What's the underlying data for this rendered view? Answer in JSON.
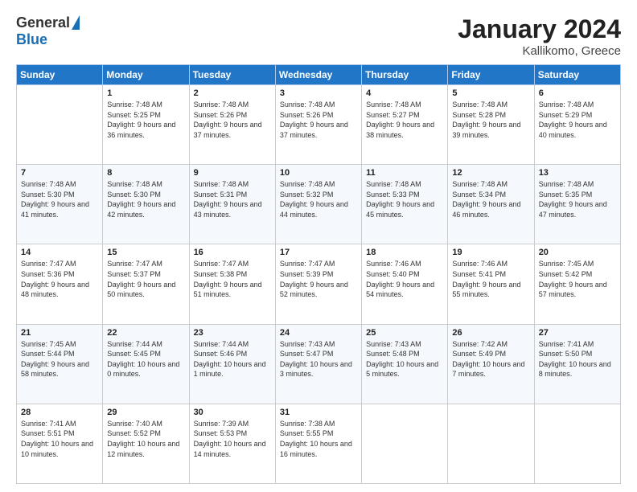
{
  "logo": {
    "general": "General",
    "blue": "Blue"
  },
  "header": {
    "title": "January 2024",
    "subtitle": "Kallikomo, Greece"
  },
  "days_of_week": [
    "Sunday",
    "Monday",
    "Tuesday",
    "Wednesday",
    "Thursday",
    "Friday",
    "Saturday"
  ],
  "weeks": [
    [
      {
        "day": "",
        "sunrise": "",
        "sunset": "",
        "daylight": ""
      },
      {
        "day": "1",
        "sunrise": "Sunrise: 7:48 AM",
        "sunset": "Sunset: 5:25 PM",
        "daylight": "Daylight: 9 hours and 36 minutes."
      },
      {
        "day": "2",
        "sunrise": "Sunrise: 7:48 AM",
        "sunset": "Sunset: 5:26 PM",
        "daylight": "Daylight: 9 hours and 37 minutes."
      },
      {
        "day": "3",
        "sunrise": "Sunrise: 7:48 AM",
        "sunset": "Sunset: 5:26 PM",
        "daylight": "Daylight: 9 hours and 37 minutes."
      },
      {
        "day": "4",
        "sunrise": "Sunrise: 7:48 AM",
        "sunset": "Sunset: 5:27 PM",
        "daylight": "Daylight: 9 hours and 38 minutes."
      },
      {
        "day": "5",
        "sunrise": "Sunrise: 7:48 AM",
        "sunset": "Sunset: 5:28 PM",
        "daylight": "Daylight: 9 hours and 39 minutes."
      },
      {
        "day": "6",
        "sunrise": "Sunrise: 7:48 AM",
        "sunset": "Sunset: 5:29 PM",
        "daylight": "Daylight: 9 hours and 40 minutes."
      }
    ],
    [
      {
        "day": "7",
        "sunrise": "Sunrise: 7:48 AM",
        "sunset": "Sunset: 5:30 PM",
        "daylight": "Daylight: 9 hours and 41 minutes."
      },
      {
        "day": "8",
        "sunrise": "Sunrise: 7:48 AM",
        "sunset": "Sunset: 5:30 PM",
        "daylight": "Daylight: 9 hours and 42 minutes."
      },
      {
        "day": "9",
        "sunrise": "Sunrise: 7:48 AM",
        "sunset": "Sunset: 5:31 PM",
        "daylight": "Daylight: 9 hours and 43 minutes."
      },
      {
        "day": "10",
        "sunrise": "Sunrise: 7:48 AM",
        "sunset": "Sunset: 5:32 PM",
        "daylight": "Daylight: 9 hours and 44 minutes."
      },
      {
        "day": "11",
        "sunrise": "Sunrise: 7:48 AM",
        "sunset": "Sunset: 5:33 PM",
        "daylight": "Daylight: 9 hours and 45 minutes."
      },
      {
        "day": "12",
        "sunrise": "Sunrise: 7:48 AM",
        "sunset": "Sunset: 5:34 PM",
        "daylight": "Daylight: 9 hours and 46 minutes."
      },
      {
        "day": "13",
        "sunrise": "Sunrise: 7:48 AM",
        "sunset": "Sunset: 5:35 PM",
        "daylight": "Daylight: 9 hours and 47 minutes."
      }
    ],
    [
      {
        "day": "14",
        "sunrise": "Sunrise: 7:47 AM",
        "sunset": "Sunset: 5:36 PM",
        "daylight": "Daylight: 9 hours and 48 minutes."
      },
      {
        "day": "15",
        "sunrise": "Sunrise: 7:47 AM",
        "sunset": "Sunset: 5:37 PM",
        "daylight": "Daylight: 9 hours and 50 minutes."
      },
      {
        "day": "16",
        "sunrise": "Sunrise: 7:47 AM",
        "sunset": "Sunset: 5:38 PM",
        "daylight": "Daylight: 9 hours and 51 minutes."
      },
      {
        "day": "17",
        "sunrise": "Sunrise: 7:47 AM",
        "sunset": "Sunset: 5:39 PM",
        "daylight": "Daylight: 9 hours and 52 minutes."
      },
      {
        "day": "18",
        "sunrise": "Sunrise: 7:46 AM",
        "sunset": "Sunset: 5:40 PM",
        "daylight": "Daylight: 9 hours and 54 minutes."
      },
      {
        "day": "19",
        "sunrise": "Sunrise: 7:46 AM",
        "sunset": "Sunset: 5:41 PM",
        "daylight": "Daylight: 9 hours and 55 minutes."
      },
      {
        "day": "20",
        "sunrise": "Sunrise: 7:45 AM",
        "sunset": "Sunset: 5:42 PM",
        "daylight": "Daylight: 9 hours and 57 minutes."
      }
    ],
    [
      {
        "day": "21",
        "sunrise": "Sunrise: 7:45 AM",
        "sunset": "Sunset: 5:44 PM",
        "daylight": "Daylight: 9 hours and 58 minutes."
      },
      {
        "day": "22",
        "sunrise": "Sunrise: 7:44 AM",
        "sunset": "Sunset: 5:45 PM",
        "daylight": "Daylight: 10 hours and 0 minutes."
      },
      {
        "day": "23",
        "sunrise": "Sunrise: 7:44 AM",
        "sunset": "Sunset: 5:46 PM",
        "daylight": "Daylight: 10 hours and 1 minute."
      },
      {
        "day": "24",
        "sunrise": "Sunrise: 7:43 AM",
        "sunset": "Sunset: 5:47 PM",
        "daylight": "Daylight: 10 hours and 3 minutes."
      },
      {
        "day": "25",
        "sunrise": "Sunrise: 7:43 AM",
        "sunset": "Sunset: 5:48 PM",
        "daylight": "Daylight: 10 hours and 5 minutes."
      },
      {
        "day": "26",
        "sunrise": "Sunrise: 7:42 AM",
        "sunset": "Sunset: 5:49 PM",
        "daylight": "Daylight: 10 hours and 7 minutes."
      },
      {
        "day": "27",
        "sunrise": "Sunrise: 7:41 AM",
        "sunset": "Sunset: 5:50 PM",
        "daylight": "Daylight: 10 hours and 8 minutes."
      }
    ],
    [
      {
        "day": "28",
        "sunrise": "Sunrise: 7:41 AM",
        "sunset": "Sunset: 5:51 PM",
        "daylight": "Daylight: 10 hours and 10 minutes."
      },
      {
        "day": "29",
        "sunrise": "Sunrise: 7:40 AM",
        "sunset": "Sunset: 5:52 PM",
        "daylight": "Daylight: 10 hours and 12 minutes."
      },
      {
        "day": "30",
        "sunrise": "Sunrise: 7:39 AM",
        "sunset": "Sunset: 5:53 PM",
        "daylight": "Daylight: 10 hours and 14 minutes."
      },
      {
        "day": "31",
        "sunrise": "Sunrise: 7:38 AM",
        "sunset": "Sunset: 5:55 PM",
        "daylight": "Daylight: 10 hours and 16 minutes."
      },
      {
        "day": "",
        "sunrise": "",
        "sunset": "",
        "daylight": ""
      },
      {
        "day": "",
        "sunrise": "",
        "sunset": "",
        "daylight": ""
      },
      {
        "day": "",
        "sunrise": "",
        "sunset": "",
        "daylight": ""
      }
    ]
  ]
}
